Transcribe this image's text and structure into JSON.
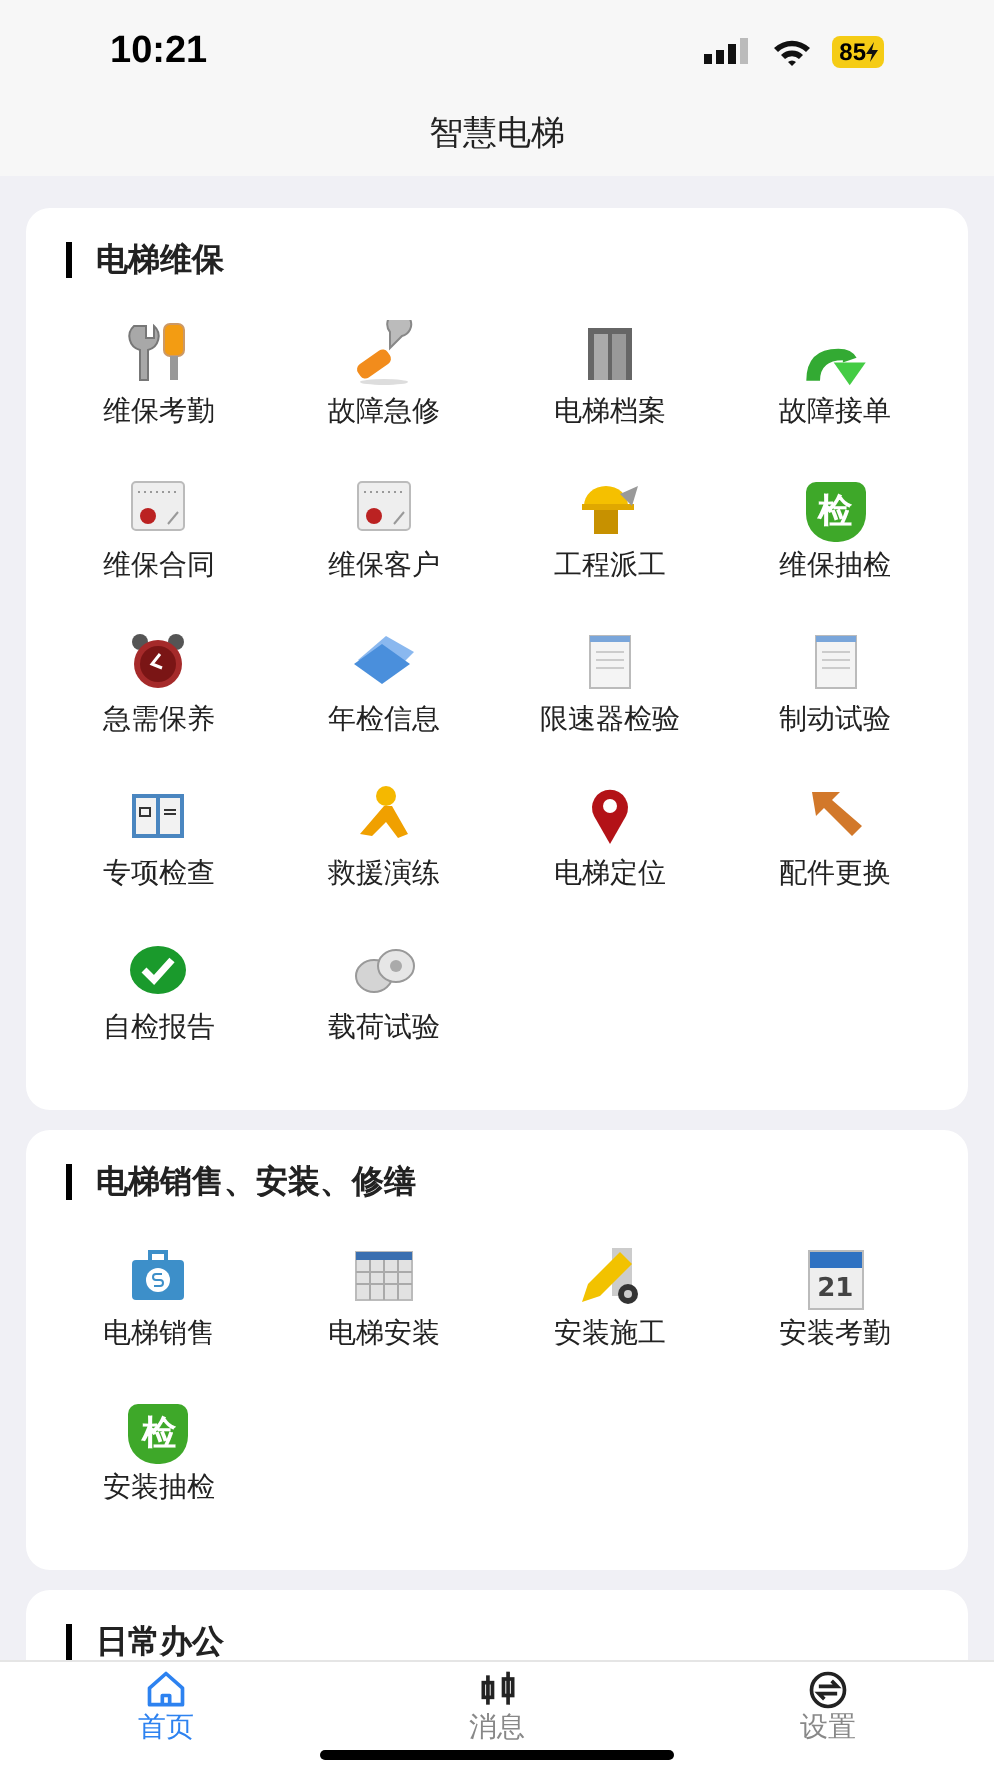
{
  "status_bar": {
    "time": "10:21",
    "battery": "85"
  },
  "title": "智慧电梯",
  "sections": [
    {
      "title": "电梯维保",
      "items": [
        {
          "label": "维保考勤",
          "kind": "tools"
        },
        {
          "label": "故障急修",
          "kind": "wrench"
        },
        {
          "label": "电梯档案",
          "kind": "cabinet"
        },
        {
          "label": "故障接单",
          "kind": "green-arrow"
        },
        {
          "label": "维保合同",
          "kind": "calendar-seal"
        },
        {
          "label": "维保客户",
          "kind": "calendar-seal"
        },
        {
          "label": "工程派工",
          "kind": "helmet"
        },
        {
          "label": "维保抽检",
          "kind": "shield",
          "badge": "检"
        },
        {
          "label": "急需保养",
          "kind": "alarm"
        },
        {
          "label": "年检信息",
          "kind": "folder"
        },
        {
          "label": "限速器检验",
          "kind": "document"
        },
        {
          "label": "制动试验",
          "kind": "document"
        },
        {
          "label": "专项检查",
          "kind": "book"
        },
        {
          "label": "救援演练",
          "kind": "runner"
        },
        {
          "label": "电梯定位",
          "kind": "pin"
        },
        {
          "label": "配件更换",
          "kind": "orange-arrow"
        },
        {
          "label": "自检报告",
          "kind": "check"
        },
        {
          "label": "载荷试验",
          "kind": "weights"
        }
      ]
    },
    {
      "title": "电梯销售、安装、修缮",
      "items": [
        {
          "label": "电梯销售",
          "kind": "money-case"
        },
        {
          "label": "电梯安装",
          "kind": "calendar-grid"
        },
        {
          "label": "安装施工",
          "kind": "pencil"
        },
        {
          "label": "安装考勤",
          "kind": "calendar-day",
          "badge": "21"
        },
        {
          "label": "安装抽检",
          "kind": "shield",
          "badge": "检"
        }
      ]
    },
    {
      "title": "日常办公"
    }
  ],
  "tabs": [
    {
      "label": "首页",
      "kind": "home",
      "selected": true
    },
    {
      "label": "消息",
      "kind": "candles",
      "selected": false
    },
    {
      "label": "设置",
      "kind": "swap",
      "selected": false
    }
  ]
}
